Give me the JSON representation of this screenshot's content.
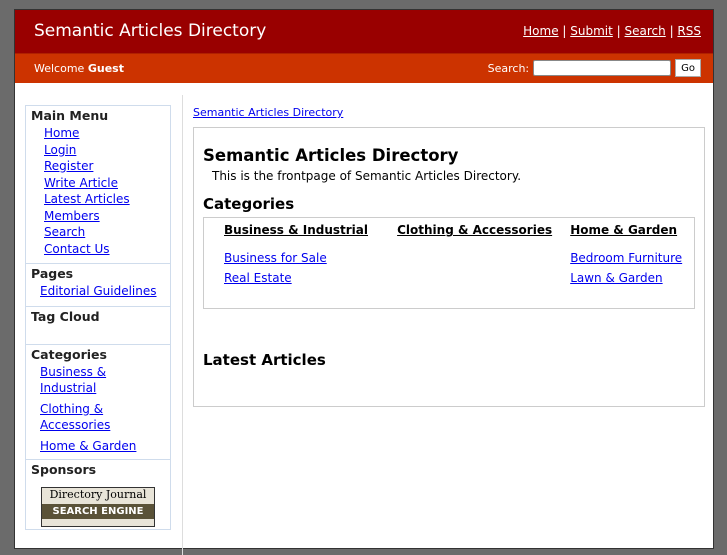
{
  "header": {
    "title": "Semantic Articles Directory",
    "links": [
      "Home",
      "Submit",
      "Search",
      "RSS"
    ],
    "welcome": "Welcome",
    "user": "Guest",
    "search_label": "Search:",
    "go": "Go"
  },
  "sidebar": {
    "main_menu": {
      "title": "Main Menu",
      "items": [
        "Home",
        "Login",
        "Register",
        "Write Article",
        "Latest Articles",
        "Members",
        "Search",
        "Contact Us"
      ]
    },
    "pages": {
      "title": "Pages",
      "items": [
        "Editorial Guidelines"
      ]
    },
    "tag_cloud": {
      "title": "Tag Cloud"
    },
    "categories": {
      "title": "Categories",
      "items": [
        "Business & Industrial",
        "Clothing & Accessories",
        "Home & Garden"
      ]
    },
    "sponsors": {
      "title": "Sponsors",
      "banner_top": "Directory Journal",
      "banner_bottom": "SEARCH ENGINE"
    }
  },
  "main": {
    "breadcrumb": "Semantic Articles Directory",
    "title": "Semantic Articles Directory",
    "intro": "This is the frontpage of Semantic Articles Directory.",
    "categories_title": "Categories",
    "categories": [
      {
        "name": "Business & Industrial",
        "subs": [
          "Business for Sale",
          "Real Estate"
        ]
      },
      {
        "name": "Clothing & Accessories",
        "subs": []
      },
      {
        "name": "Home & Garden",
        "subs": [
          "Bedroom Furniture",
          "Lawn & Garden"
        ]
      }
    ],
    "latest_title": "Latest Articles"
  }
}
